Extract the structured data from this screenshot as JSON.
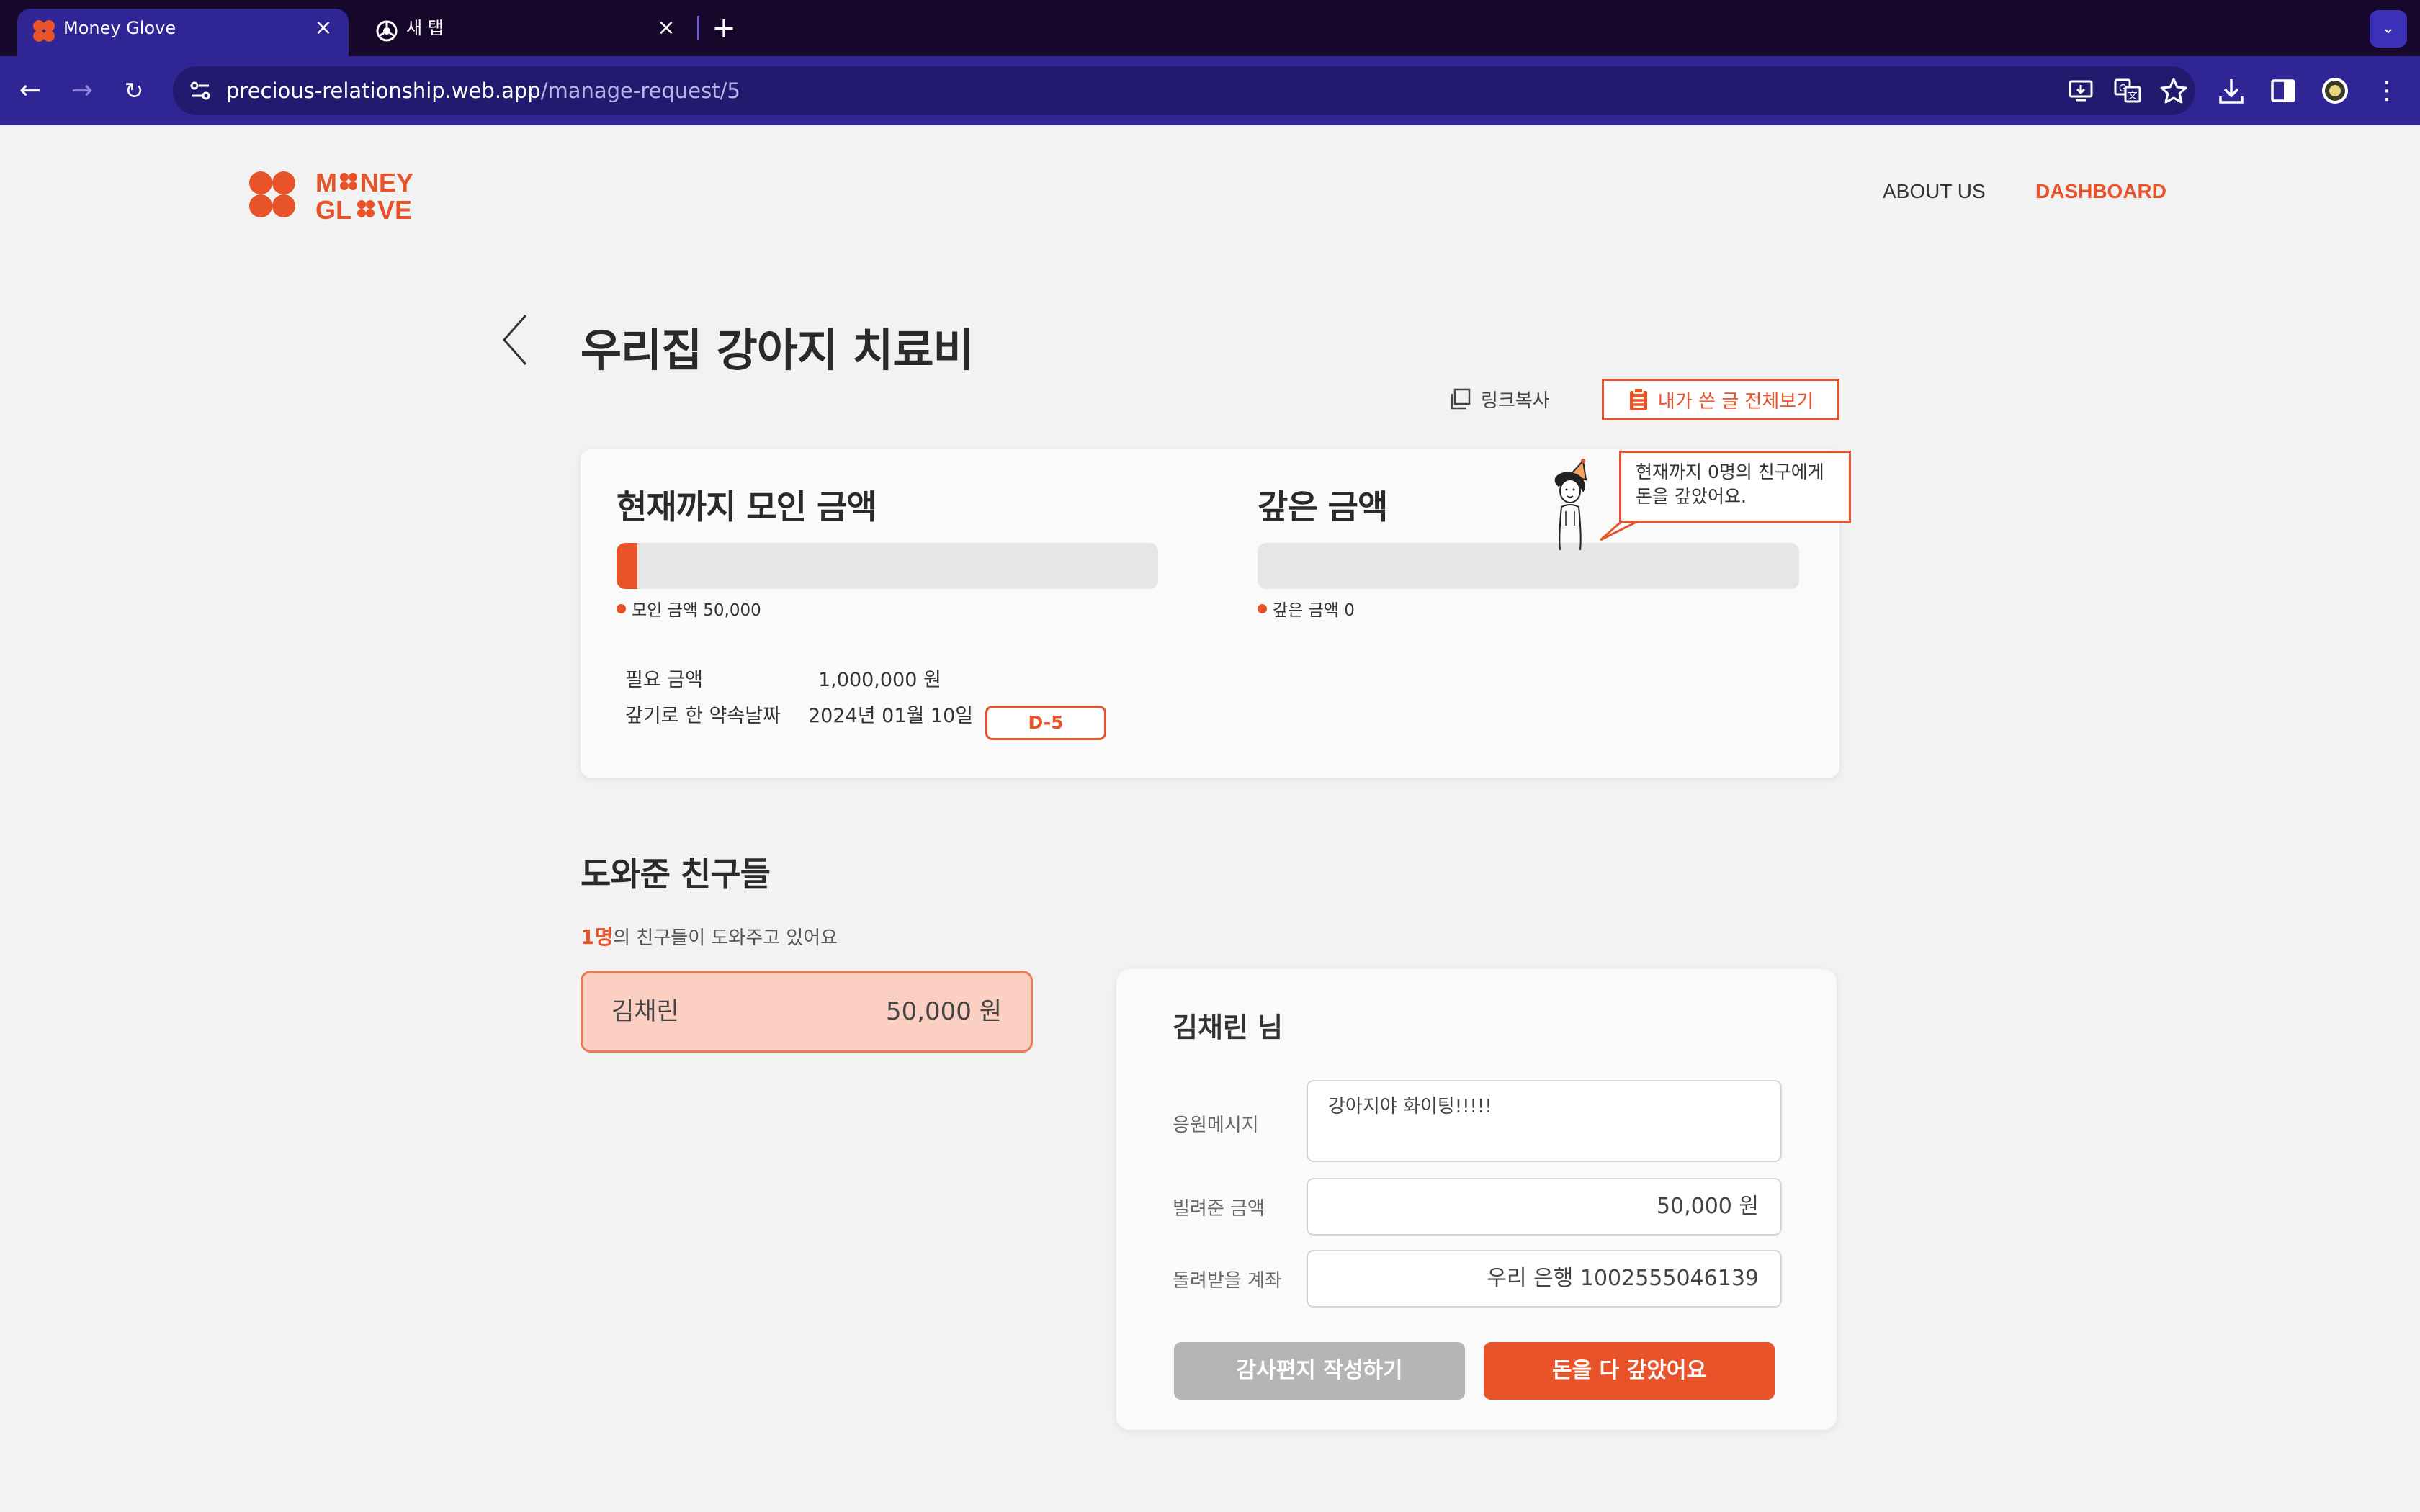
{
  "browser": {
    "tabs": [
      {
        "title": "Money Glove",
        "active": true
      },
      {
        "title": "새 탭",
        "active": false
      }
    ],
    "url_host": "precious-relationship.web.app",
    "url_path": "/manage-request/5",
    "accent_color": "#2f2594"
  },
  "site": {
    "logo_text": "MONEY GLOVE",
    "nav": {
      "about": "ABOUT US",
      "dashboard": "DASHBOARD"
    },
    "brand_color": "#e8532a"
  },
  "request": {
    "title": "우리집 강아지 치료비",
    "copy_link": "링크복사",
    "view_all": "내가 쓴 글 전체보기"
  },
  "summary": {
    "collected_title": "현재까지 모인 금액",
    "collected_caption": "모인 금액 50,000",
    "collected_ratio": 0.05,
    "repaid_title": "갚은 금액",
    "repaid_caption": "갚은 금액 0",
    "repaid_ratio": 0,
    "bubble_line1": "현재까지 0명의 친구에게",
    "bubble_line2": "돈을 갚았어요.",
    "required_label": "필요 금액",
    "required_value": "1,000,000 원",
    "due_label": "갚기로 한 약속날짜",
    "due_value": "2024년 01월 10일",
    "dday": "D-5"
  },
  "helpers": {
    "title": "도와준 친구들",
    "count_num": "1명",
    "count_text": "의 친구들이 도와주고 있어요",
    "list": [
      {
        "name": "김채린",
        "amount": "50,000 원"
      }
    ]
  },
  "detail": {
    "name": "김채린 님",
    "message_label": "응원메시지",
    "message": "강아지야 화이팅!!!!!",
    "amount_label": "빌려준 금액",
    "amount": "50,000 원",
    "account_label": "돌려받을 계좌",
    "account": "우리 은행 1002555046139",
    "thanks_button": "감사편지 작성하기",
    "repaid_button": "돈을 다 갚았어요"
  }
}
